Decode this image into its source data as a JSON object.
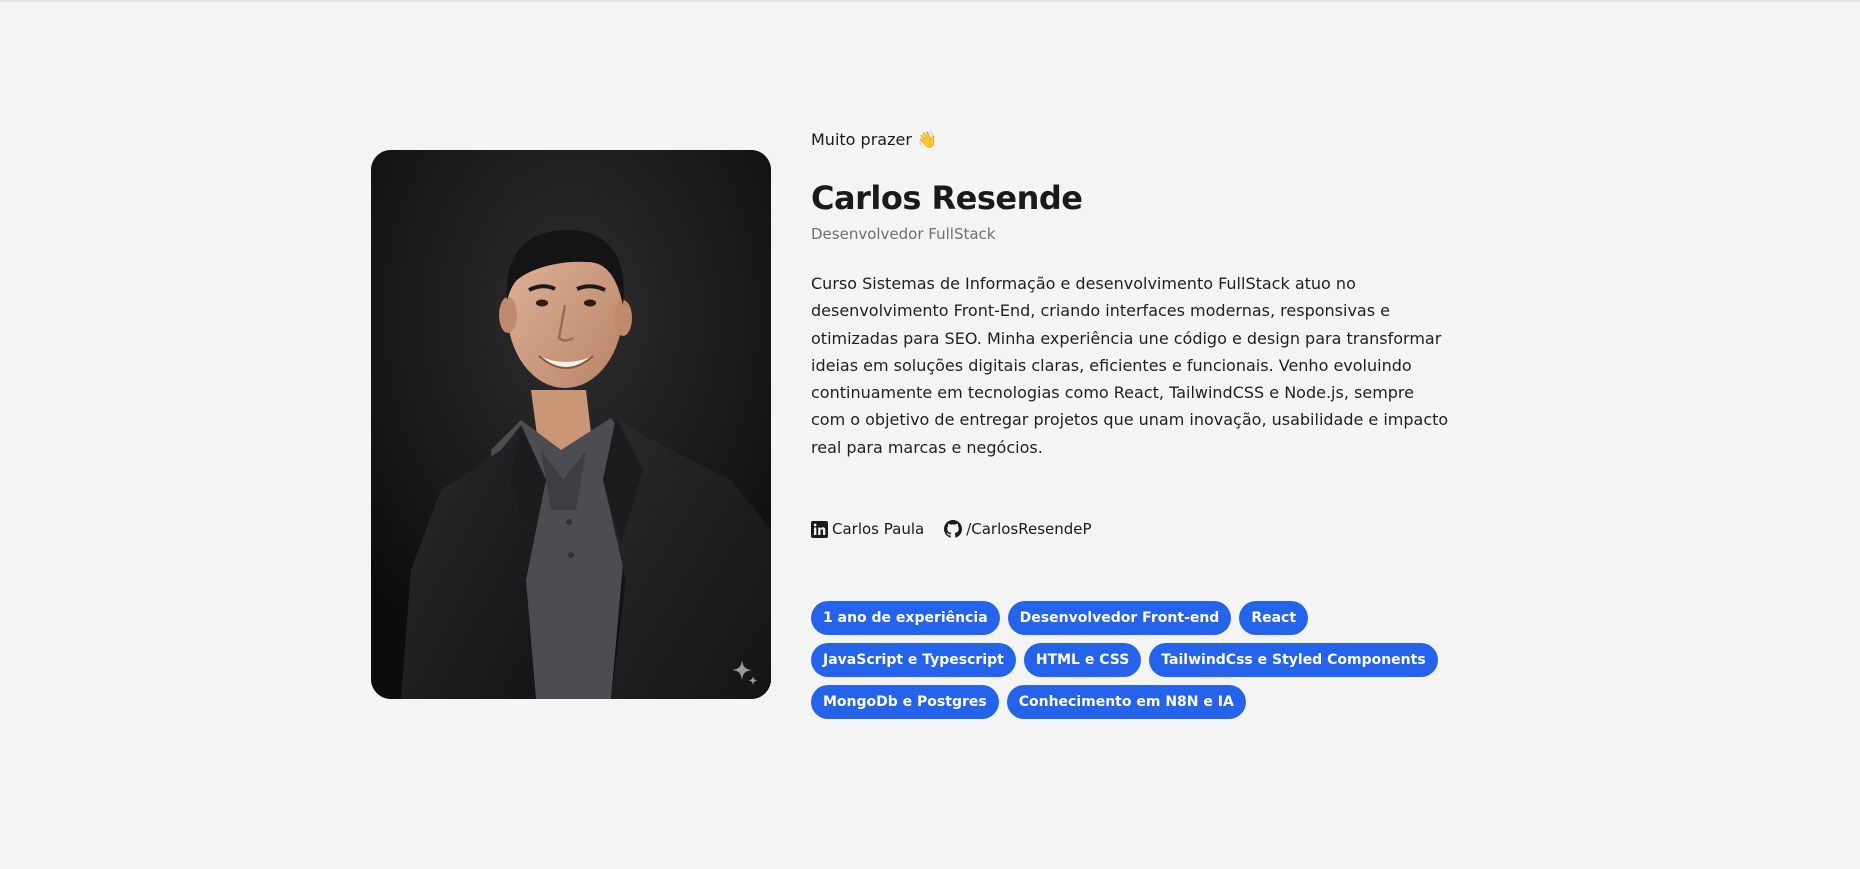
{
  "profile": {
    "greeting": "Muito prazer 👋",
    "name": "Carlos Resende",
    "role": "Desenvolvedor FullStack",
    "bio": "Curso Sistemas de Informação e desenvolvimento FullStack atuo no desenvolvimento Front-End, criando interfaces modernas, responsivas e otimizadas para SEO. Minha experiência une código e design para transformar ideias em soluções digitais claras, eficientes e funcionais. Venho evoluindo continuamente em tecnologias como React, TailwindCSS e Node.js, sempre com o objetivo de entregar projetos que unam inovação, usabilidade e impacto real para marcas e negócios."
  },
  "socials": {
    "linkedin": {
      "icon": "linkedin-icon",
      "label": "Carlos Paula"
    },
    "github": {
      "icon": "github-icon",
      "label": "/CarlosResendeP"
    }
  },
  "tags": [
    "1 ano de experiência",
    "Desenvolvedor Front-end",
    "React",
    "JavaScript e Typescript",
    "HTML e CSS",
    "TailwindCss e Styled Components",
    "MongoDb e Postgres",
    "Conhecimento em N8N e IA"
  ],
  "colors": {
    "background": "#f4f4f4",
    "tag_background": "#2563eb",
    "tag_text": "#ffffff",
    "role_text": "#6f6f6f"
  },
  "photo": {
    "icon": "sparkle-icon"
  }
}
